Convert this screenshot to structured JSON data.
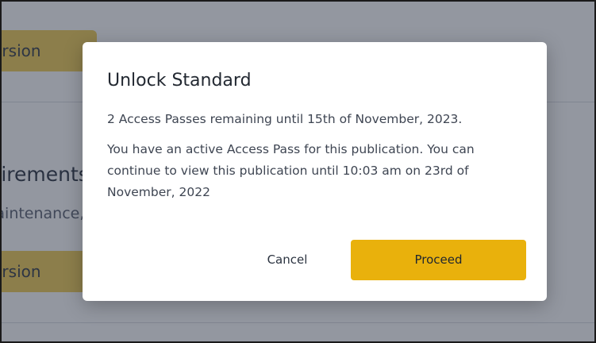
{
  "background": {
    "top_button_label": "Version",
    "section_heading": "Requirements",
    "section_subtext": "Maintenance, lab",
    "bottom_button_label": "Version"
  },
  "dialog": {
    "title": "Unlock Standard",
    "passes_remaining": "2 Access Passes remaining until 15th of November, 2023.",
    "active_pass_message": "You have an active Access Pass for this publication. You can continue to view this publication until 10:03 am on 23rd of November, 2022",
    "cancel_label": "Cancel",
    "proceed_label": "Proceed"
  },
  "colors": {
    "accent": "#e9b10c",
    "overlay": "#282f42"
  }
}
